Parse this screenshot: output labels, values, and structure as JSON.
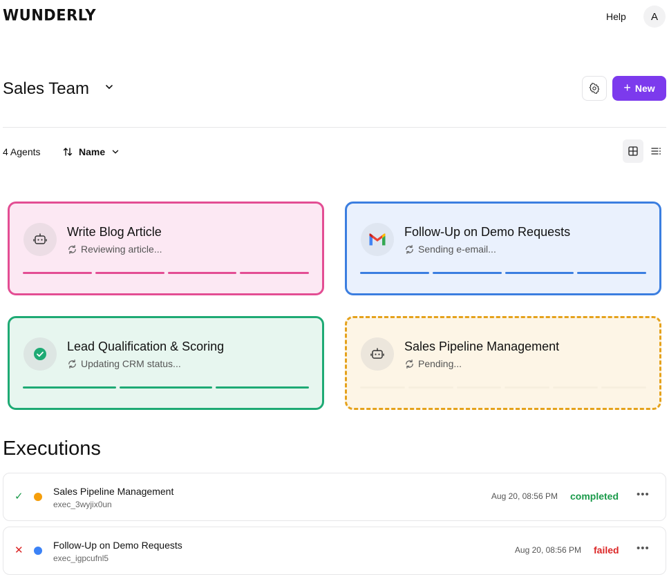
{
  "brand": {
    "logo": "WUNDERLY"
  },
  "header": {
    "help_label": "Help",
    "avatar_initial": "A"
  },
  "team": {
    "name": "Sales Team",
    "new_button_label": "New"
  },
  "toolbar": {
    "agents_count": "4 Agents",
    "sort_label": "Name"
  },
  "agents": [
    {
      "title": "Write Blog Article",
      "status": "Reviewing article...",
      "icon": "robot-icon",
      "color": "#e34d93",
      "progress_segments": 4
    },
    {
      "title": "Follow-Up on Demo Requests",
      "status": "Sending e-email...",
      "icon": "gmail-icon",
      "color": "#3b7ee0",
      "progress_segments": 4
    },
    {
      "title": "Lead Qualification & Scoring",
      "status": "Updating CRM status...",
      "icon": "check-circle-icon",
      "color": "#1eaa74",
      "progress_segments": 3
    },
    {
      "title": "Sales Pipeline Management",
      "status": "Pending...",
      "icon": "robot-icon",
      "color": "#e5a21c",
      "progress_segments": 6
    }
  ],
  "executions": {
    "title": "Executions",
    "rows": [
      {
        "name": "Sales Pipeline Management",
        "id": "exec_3wyjix0un",
        "time": "Aug 20, 08:56 PM",
        "status": "completed",
        "status_color": "#1a9a4a",
        "mark": "✓",
        "dot_color": "#f59e0b"
      },
      {
        "name": "Follow-Up on Demo Requests",
        "id": "exec_igpcufnl5",
        "time": "Aug 20, 08:56 PM",
        "status": "failed",
        "status_color": "#dc2626",
        "mark": "✕",
        "dot_color": "#3b82f6"
      }
    ]
  }
}
